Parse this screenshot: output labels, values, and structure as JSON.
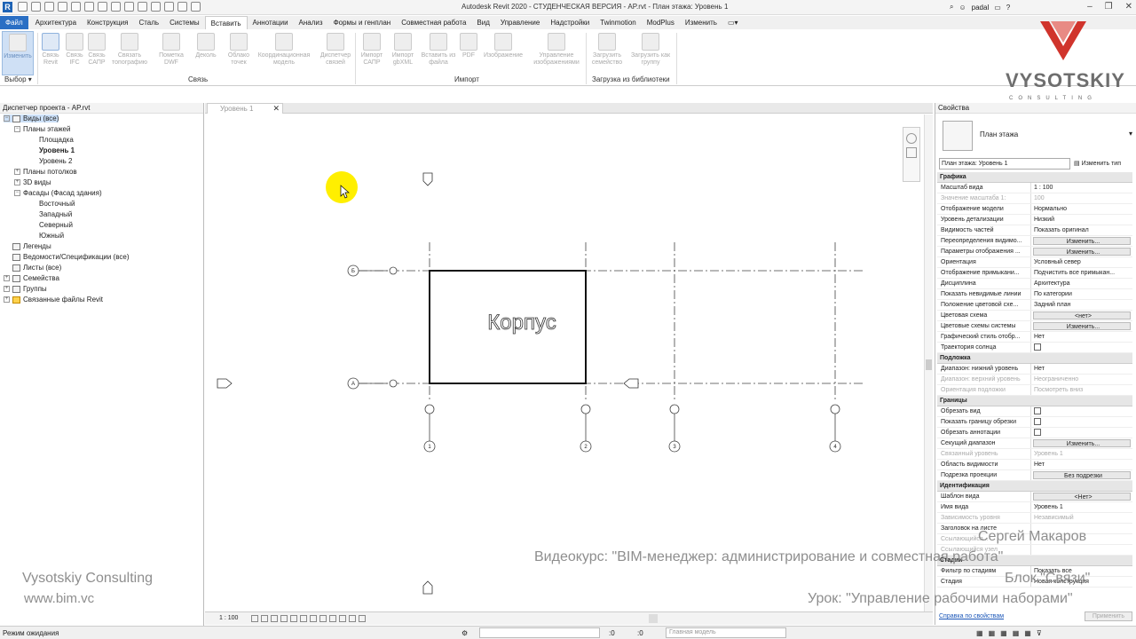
{
  "window": {
    "title": "Autodesk Revit 2020 - СТУДЕНЧЕСКАЯ ВЕРСИЯ - AP.rvt - План этажа: Уровень 1",
    "user": "padal"
  },
  "ribbon_tabs": [
    "Файл",
    "Архитектура",
    "Конструкция",
    "Сталь",
    "Системы",
    "Вставить",
    "Аннотации",
    "Анализ",
    "Формы и генплан",
    "Совместная работа",
    "Вид",
    "Управление",
    "Надстройки",
    "Twinmotion",
    "ModPlus",
    "Изменить"
  ],
  "ribbon_buttons": [
    {
      "label": "Изменить"
    },
    {
      "label": "Связь Revit"
    },
    {
      "label": "Связь IFC"
    },
    {
      "label": "Связь САПР"
    },
    {
      "label": "Связать топографию"
    },
    {
      "label": "Пометка DWF"
    },
    {
      "label": "Деколь"
    },
    {
      "label": "Облако точек"
    },
    {
      "label": "Координационная модель"
    },
    {
      "label": "Диспетчер связей"
    },
    {
      "label": "Импорт САПР"
    },
    {
      "label": "Импорт gbXML"
    },
    {
      "label": "Вставить из файла"
    },
    {
      "label": "PDF"
    },
    {
      "label": "Изображение"
    },
    {
      "label": "Управление изображениями"
    },
    {
      "label": "Загрузить семейство"
    },
    {
      "label": "Загрузить как группу"
    }
  ],
  "ribbon_groups": {
    "select": "Выбор",
    "link": "Связь",
    "import": "Импорт",
    "library": "Загрузка из библиотеки"
  },
  "browser": {
    "title": "Диспетчер проекта - AP.rvt",
    "items": [
      {
        "label": "Виды (все)",
        "toggle": "−"
      },
      {
        "label": "Планы этажей",
        "toggle": "−"
      },
      {
        "label": "Площадка"
      },
      {
        "label": "Уровень 1"
      },
      {
        "label": "Уровень 2"
      },
      {
        "label": "Планы потолков",
        "toggle": "+"
      },
      {
        "label": "3D виды",
        "toggle": "+"
      },
      {
        "label": "Фасады (Фасад здания)",
        "toggle": "−"
      },
      {
        "label": "Восточный"
      },
      {
        "label": "Западный"
      },
      {
        "label": "Северный"
      },
      {
        "label": "Южный"
      },
      {
        "label": "Легенды"
      },
      {
        "label": "Ведомости/Спецификации (все)"
      },
      {
        "label": "Листы (все)"
      },
      {
        "label": "Семейства",
        "toggle": "+"
      },
      {
        "label": "Группы",
        "toggle": "+"
      },
      {
        "label": "Связанные файлы Revit",
        "toggle": "+"
      }
    ]
  },
  "view": {
    "tab_label": "Уровень 1",
    "room_label": "Корпус",
    "grid_rows": [
      "Б",
      "А"
    ],
    "grid_cols": [
      "1",
      "2",
      "3",
      "4"
    ],
    "scale": "1 : 100"
  },
  "properties": {
    "title": "Свойства",
    "type_name": "План этажа",
    "instance_selector": "План этажа: Уровень 1",
    "edit_type": "Изменить тип",
    "sections": [
      {
        "name": "Графика",
        "rows": [
          {
            "k": "Масштаб вида",
            "v": "1 : 100"
          },
          {
            "k": "Значение масштаба    1:",
            "v": "100"
          },
          {
            "k": "Отображение модели",
            "v": "Нормально"
          },
          {
            "k": "Уровень детализации",
            "v": "Низкий"
          },
          {
            "k": "Видимость частей",
            "v": "Показать оригинал"
          },
          {
            "k": "Переопределения видимо...",
            "v": "Изменить..."
          },
          {
            "k": "Параметры отображения ...",
            "v": "Изменить..."
          },
          {
            "k": "Ориентация",
            "v": "Условный север"
          },
          {
            "k": "Отображение примыкани...",
            "v": "Подчистить все примыкан..."
          },
          {
            "k": "Дисциплина",
            "v": "Архитектура"
          },
          {
            "k": "Показать невидимые линии",
            "v": "По категории"
          },
          {
            "k": "Положение цветовой схе...",
            "v": "Задний план"
          },
          {
            "k": "Цветовая схема",
            "v": "<нет>"
          },
          {
            "k": "Цветовые схемы системы",
            "v": "Изменить..."
          },
          {
            "k": "Графический стиль отобр...",
            "v": "Нет"
          },
          {
            "k": "Траектория солнца",
            "v": ""
          }
        ]
      },
      {
        "name": "Подложка",
        "rows": [
          {
            "k": "Диапазон: нижний уровень",
            "v": "Нет"
          },
          {
            "k": "Диапазон: верхний уровень",
            "v": "Неограниченно"
          },
          {
            "k": "Ориентация подложки",
            "v": "Посмотреть вниз"
          }
        ]
      },
      {
        "name": "Границы",
        "rows": [
          {
            "k": "Обрезать вид",
            "v": ""
          },
          {
            "k": "Показать границу обрезки",
            "v": ""
          },
          {
            "k": "Обрезать аннотации",
            "v": ""
          },
          {
            "k": "Секущий диапазон",
            "v": "Изменить..."
          },
          {
            "k": "Связанный уровень",
            "v": "Уровень 1"
          },
          {
            "k": "Область видимости",
            "v": "Нет"
          },
          {
            "k": "Подрезка проекции",
            "v": "Без подрезки"
          }
        ]
      },
      {
        "name": "Идентификация",
        "rows": [
          {
            "k": "Шаблон вида",
            "v": "<Нет>"
          },
          {
            "k": "Имя вида",
            "v": "Уровень 1"
          },
          {
            "k": "Зависимость уровня",
            "v": "Независимый"
          },
          {
            "k": "Заголовок на листе",
            "v": ""
          },
          {
            "k": "Ссылающийся...",
            "v": ""
          },
          {
            "k": "Ссылающийся узел",
            "v": ""
          }
        ]
      },
      {
        "name": "Стадии",
        "rows": [
          {
            "k": "Фильтр по стадиям",
            "v": "Показать все"
          },
          {
            "k": "Стадия",
            "v": "Новая конструкция"
          }
        ]
      }
    ],
    "help_link": "Справка по свойствам",
    "apply": "Применить"
  },
  "status": {
    "left": "Режим ожидания",
    "zero1": ":0",
    "zero2": ":0",
    "model": "Главная модель"
  },
  "overlay": {
    "brand": "VYSOTSKIY",
    "brand_sub": "CONSULTING",
    "company": "Vysotskiy Consulting",
    "site": "www.bim.vc",
    "author": "Сергей Макаров",
    "course": "Видеокурс: \"BIM-менеджер: администрирование и совместная работа\"",
    "block": "Блок \"Связи\"",
    "lesson": "Урок: \"Управление рабочими наборами\""
  },
  "colors": {
    "accent": "#2a6fc4",
    "cursor_highlight": "#ffef00",
    "logo_red": "#d0342c"
  }
}
